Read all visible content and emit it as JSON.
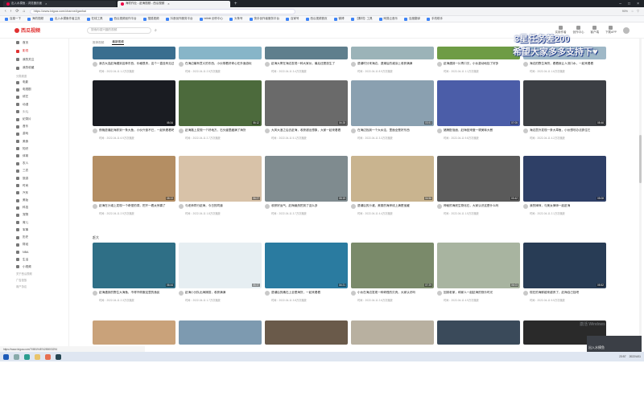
{
  "browser": {
    "tabs": [
      {
        "label": "出入水摸鱼 - 浏览器页面",
        "active": false
      },
      {
        "label": "海钓作业 - 赶海视频 - 西瓜视频",
        "active": true
      }
    ],
    "url": "https://www.ixigua.com/channel/ganhai",
    "addr_right": [
      "90%",
      "☆",
      "▽"
    ],
    "bookmarks": [
      "百度一下",
      "海钓视频",
      "出入水摸鱼作者主页",
      "在线工具",
      "西瓜视频创作平台",
      "搜狐视频",
      "抖音创作服务平台",
      "bilibili 创作中心",
      "头条号",
      "快手创作者服务平台",
      "百家号",
      "西瓜视频首页",
      "微博",
      "【素材】工具",
      "网易云音乐",
      "百度翻译",
      "手机助手"
    ]
  },
  "site": {
    "logo": "西瓜视频",
    "search_placeholder": "搜索你感兴趣的视频",
    "header_actions": [
      "实用作者",
      "创作中心",
      "客户端",
      "下载APP"
    ]
  },
  "sidebar": {
    "items": [
      {
        "label": "首页",
        "icon": "home-icon",
        "active": false
      },
      {
        "label": "影视",
        "icon": "film-icon",
        "active": true
      },
      {
        "label": "我的关注",
        "icon": "star-icon",
        "active": false
      },
      {
        "label": "我的收藏",
        "icon": "bookmark-icon",
        "active": false
      }
    ],
    "section_label": "分类频道",
    "categories": [
      "电影",
      "电视剧",
      "综艺",
      "动漫",
      "少儿",
      "纪录片",
      "音乐",
      "游戏",
      "美食",
      "知识",
      "体育",
      "农人",
      "三农",
      "旅游",
      "时尚",
      "汽车",
      "美妆",
      "科技",
      "宠物",
      "育儿",
      "军事",
      "历史",
      "财经",
      "NBA",
      "生活",
      "小视频"
    ],
    "footer": [
      "关于西瓜视频",
      "广告投放",
      "用户协议"
    ]
  },
  "main": {
    "subtabs": [
      {
        "label": "推荐视频",
        "active": false
      },
      {
        "label": "最新视频",
        "active": true
      }
    ],
    "section2_label": "赶大",
    "row1": [
      {
        "title": "我去大连赶海遇到这种东西，价格很贵，这个一直没有见过",
        "meta": "时间：2022-04-11 1.2万次播放",
        "color": "#3a6e8f"
      },
      {
        "title": "在海边最有意义的东西，小伙带着好奇心在外面游玩",
        "meta": "时间：2022-04-11 2.5万次播放",
        "color": "#87b5c8"
      },
      {
        "title": "赶海大哥在海边发现一种大家伙，最后还是放生了",
        "meta": "时间：2022-04-11 3.4万次播放",
        "color": "#5f7f8d"
      },
      {
        "title": "退潮时分来海边，退潮后的滩涂上收获满满",
        "meta": "时间：2022-04-11 8.9万次播放",
        "color": "#9bb3b8"
      },
      {
        "title": "赶海遇到一片青口贝，小伙激动地捡了好多",
        "meta": "时间：2022-04-11 1.1万次播放",
        "color": "#6e9c45"
      },
      {
        "title": "海边的野生海货，看着就让人流口水，一起来看看",
        "meta": "时间：2022-04-11 1.6万次播放",
        "color": "#9fb8c7"
      }
    ],
    "row2": [
      {
        "title": "夜晚退潮赶海抓到一条大鱼，小伙兴奋不已，一起来看看吧",
        "meta": "时间：2022-04-11 6.9万次播放",
        "dur": "05:34",
        "color": "#1a1c22"
      },
      {
        "title": "赶海路上发现一个好地方，石头缝里藏满了海货",
        "meta": "时间：2022-04-11 2.7万次播放",
        "dur": "06:12",
        "color": "#4c6a3c"
      },
      {
        "title": "大风大浪之后去赶海，收获超出想象，大家一起来看看",
        "meta": "时间：2022-04-11 5.1万次播放",
        "dur": "04:28",
        "color": "#6a6a6a"
      },
      {
        "title": "在海边找到一个大水洼，里面全是好东西",
        "meta": "时间：2022-04-11 3.3万次播放",
        "dur": "03:51",
        "color": "#8aa0b0"
      },
      {
        "title": "猪蹄配泡面，赶海回来做一顿美味大餐",
        "meta": "时间：2022-04-11 9.8万次播放",
        "dur": "07:05",
        "color": "#4b5da8"
      },
      {
        "title": "海边意外发现一条大章鱼，小伙想尽办法抓住它",
        "meta": "时间：2022-04-11 4.2万次播放",
        "dur": "05:46",
        "color": "#3c3f44"
      }
    ],
    "row3": [
      {
        "title": "赶海在沙滩上发现一个奇怪的洞，挖开一看太惊喜了",
        "meta": "时间：2022-04-11 2.9万次播放",
        "dur": "08:13",
        "color": "#b48e63"
      },
      {
        "title": "与老师同行赶海，今日的同道",
        "meta": "时间：2022-04-11 1.8万次播放",
        "dur": "06:27",
        "color": "#d8c2a8"
      },
      {
        "title": "收获好运气，赶海竟然挖到了这么多",
        "meta": "时间：2022-04-11 3.7万次播放",
        "dur": "05:19",
        "color": "#7f8b8f"
      },
      {
        "title": "退潮后的沙滩，美丽的海岸线上满是宝藏",
        "meta": "时间：2022-04-11 4.4万次播放",
        "dur": "04:56",
        "color": "#c9b48f"
      },
      {
        "title": "神秘的海底生物化石，大家认识这是什么吗",
        "meta": "时间：2022-04-11 1.5万次播放",
        "dur": "03:42",
        "color": "#5a5a5a"
      },
      {
        "title": "我的律师，与美女律师一起赶海",
        "meta": "时间：2022-04-11 2.1万次播放",
        "dur": "05:08",
        "color": "#2e3f66"
      }
    ],
    "row4": [
      {
        "title": "赶海遇到的野生大海鱼，不得不佩服这里的渔民",
        "meta": "时间：2022-04-11 2.3万次播放",
        "dur": "06:44",
        "color": "#2f6f86"
      },
      {
        "title": "赶海小分队出海捕捞，收获满满",
        "meta": "时间：2022-04-11 1.7万次播放",
        "dur": "05:37",
        "color": "#e6eef2"
      },
      {
        "title": "退潮后的礁石上全是海货，一起来看看",
        "meta": "时间：2022-04-11 3.8万次播放",
        "dur": "04:21",
        "color": "#2a7ba0"
      },
      {
        "title": "小伙在海边发现一种奇怪的贝壳，大家认识吗",
        "meta": "时间：2022-04-11 2.6万次播放",
        "dur": "07:29",
        "color": "#7a8a6a"
      },
      {
        "title": "回到老家，和家人一起赶海的快乐时光",
        "meta": "时间：2022-04-11 4.9万次播放",
        "dur": "06:03",
        "color": "#a8b4a0"
      },
      {
        "title": "现在的海鲜越来越贵了，赶海自己捡吧",
        "meta": "时间：2022-04-11 5.5万次播放",
        "dur": "05:52",
        "color": "#283c55"
      }
    ],
    "row5_colors": [
      "#c9a27a",
      "#7d9ab0",
      "#6a5a4a",
      "#b8b0a0",
      "#3a4a5a",
      "#2a2a2a"
    ]
  },
  "overlay": {
    "line1": "3星任务差200",
    "line2": "希望大家多多支持下♥"
  },
  "watermark": "激活 Windows",
  "camera_label": "出入水摸鱼",
  "status_url": "https://www.ixigua.com/7085194874285003294",
  "taskbar": {
    "time": "23:57",
    "date": "2022/4/11"
  }
}
